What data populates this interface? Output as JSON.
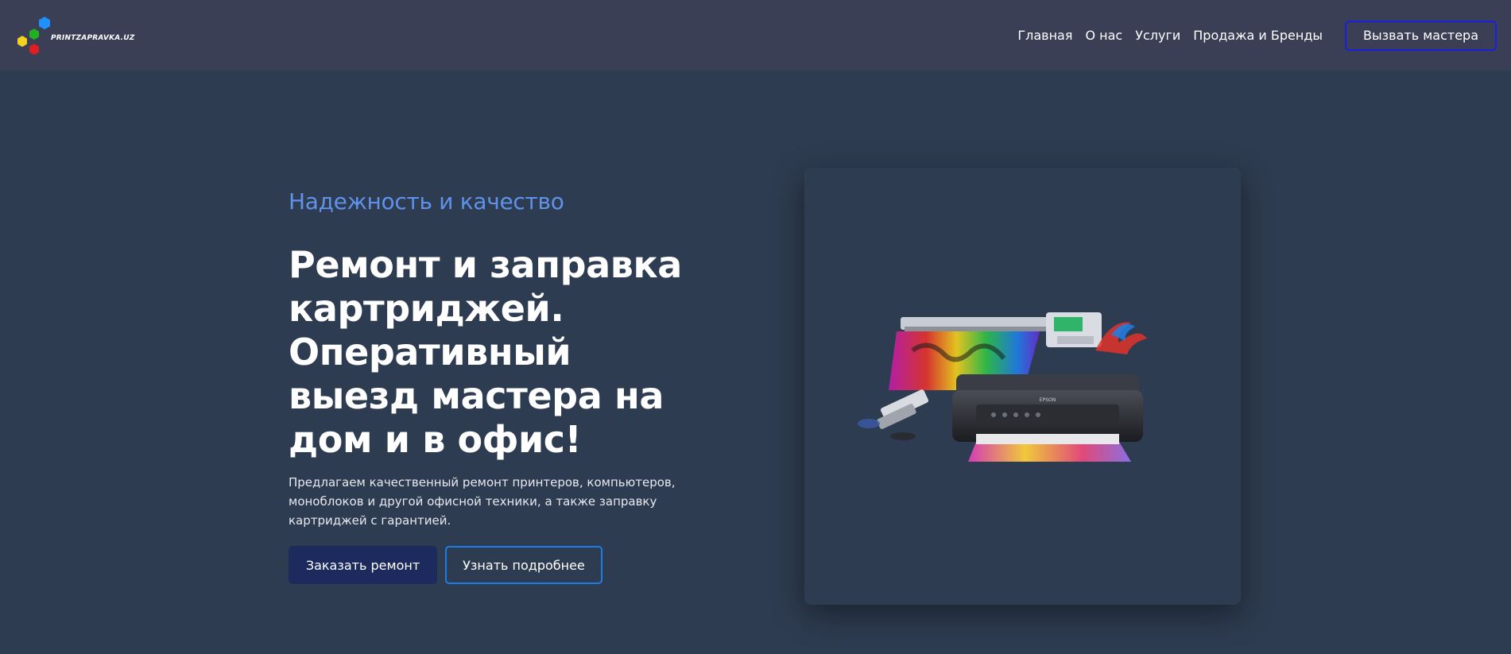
{
  "header": {
    "logo_text": "PRINTZAPRAVKA.UZ",
    "nav": [
      {
        "label": "Главная"
      },
      {
        "label": "О нас"
      },
      {
        "label": "Услуги"
      },
      {
        "label": "Продажа и Бренды"
      }
    ],
    "cta_label": "Вызвать мастера"
  },
  "hero": {
    "tagline": "Надежность и качество",
    "title": "Ремонт и заправка картриджей. Оперативный выезд мастера на дом и в офис!",
    "description": "Предлагаем качественный ремонт принтеров, компьютеров, моноблоков и другой офисной техники, а также заправку картриджей с гарантией.",
    "primary_button": "Заказать ремонт",
    "secondary_button": "Узнать подробнее"
  },
  "image": {
    "printer_brand": "EPSON"
  },
  "colors": {
    "page_bg": "#2e3c51",
    "header_bg": "#3b3f56",
    "accent": "#5f92e8",
    "cta_border": "#1b1fe0",
    "primary_button_bg": "#1c2a5e",
    "outline_button_border": "#1a7de8",
    "logo_hex_colors": [
      "#1e90ff",
      "#22b022",
      "#f2d21c",
      "#e21d1d"
    ]
  },
  "icons": {
    "logo": "hexagon-cluster-icon"
  }
}
